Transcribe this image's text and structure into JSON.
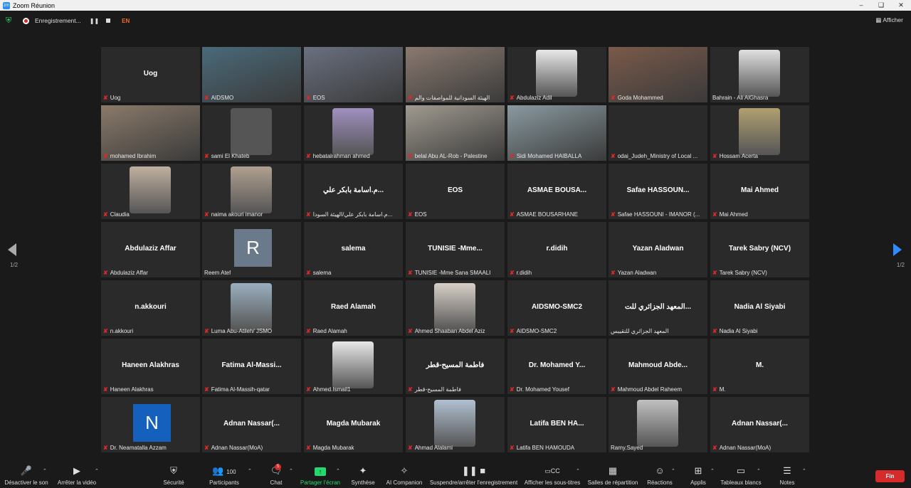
{
  "window": {
    "title": "Zoom Réunion"
  },
  "topbar": {
    "recording_label": "Enregistrement...",
    "language": "EN",
    "view_label": "Afficher"
  },
  "pager": {
    "left": "1/2",
    "right": "1/2"
  },
  "tiles": [
    {
      "name": "Uog",
      "label": "Uog",
      "kind": "text"
    },
    {
      "name": "",
      "label": "AIDSMO",
      "kind": "video",
      "speaker": true,
      "bg": "#4a6a7a"
    },
    {
      "name": "",
      "label": "EOS",
      "kind": "video",
      "bg": "#6a7080"
    },
    {
      "name": "",
      "label": "الهيئة السودانية للمواصفات والم",
      "kind": "video",
      "bg": "#8a7a70"
    },
    {
      "name": "",
      "label": "Abdulaziz Adil",
      "kind": "photo",
      "bg": "#e8e8e8"
    },
    {
      "name": "",
      "label": "Goda Mohammed",
      "kind": "video",
      "bg": "#7a5a4a"
    },
    {
      "name": "",
      "label": "Bahrain - Ali AlGhasra",
      "kind": "photo",
      "bg": "#e0e0e0",
      "nomic": true
    },
    {
      "name": "",
      "label": "mohamed Ibrahim",
      "kind": "video",
      "bg": "#8a7a6a"
    },
    {
      "name": "",
      "label": "sami El Khateb",
      "kind": "photo",
      "bg": "#555"
    },
    {
      "name": "",
      "label": "hebatalrahman ahmed",
      "kind": "photo",
      "bg": "#a090c0"
    },
    {
      "name": "",
      "label": "belal Abu AL-Rob - Palestine",
      "kind": "video",
      "bg": "#a09a90"
    },
    {
      "name": "",
      "label": "Sidi Mohamed HAIBALLA",
      "kind": "video",
      "bg": "#8a9aa0"
    },
    {
      "name": "",
      "label": "odai_Judeh_Ministry of Local ...",
      "kind": "text"
    },
    {
      "name": "",
      "label": "Hossam Acerta",
      "kind": "photo",
      "bg": "#b0a070"
    },
    {
      "name": "",
      "label": "Claudia",
      "kind": "photo",
      "bg": "#c0b0a0"
    },
    {
      "name": "",
      "label": "naima akouri imanor",
      "kind": "photo",
      "bg": "#b0a090"
    },
    {
      "name": "م.اسامة بابكر علي...",
      "label": "م.اسامة بابكر علي/الهيئة السودا...",
      "kind": "text"
    },
    {
      "name": "EOS",
      "label": "EOS",
      "kind": "text"
    },
    {
      "name": "ASMAE  BOUSA...",
      "label": "ASMAE BOUSARHANE",
      "kind": "text"
    },
    {
      "name": "Safae  HASSOUN...",
      "label": "Safae HASSOUNI - IMANOR (...",
      "kind": "text"
    },
    {
      "name": "Mai Ahmed",
      "label": "Mai Ahmed",
      "kind": "text"
    },
    {
      "name": "Abdulaziz Affar",
      "label": "Abdulaziz Affar",
      "kind": "text"
    },
    {
      "name": "R",
      "label": "Reem Atef",
      "kind": "avatar",
      "bg": "#6a7a8a",
      "nomic": true
    },
    {
      "name": "salema",
      "label": "salema",
      "kind": "text"
    },
    {
      "name": "TUNISIE  -Mme...",
      "label": "TUNISIE -Mme Sana SMAALI",
      "kind": "text"
    },
    {
      "name": "r.didih",
      "label": "r.didih",
      "kind": "text"
    },
    {
      "name": "Yazan Aladwan",
      "label": "Yazan Aladwan",
      "kind": "text"
    },
    {
      "name": "Tarek Sabry (NCV)",
      "label": "Tarek Sabry (NCV)",
      "kind": "text"
    },
    {
      "name": "n.akkouri",
      "label": "n.akkouri",
      "kind": "text"
    },
    {
      "name": "",
      "label": "Luma Abu-Atileh/ JSMO",
      "kind": "photo",
      "bg": "#9ab0c0"
    },
    {
      "name": "Raed Alamah",
      "label": "Raed Alamah",
      "kind": "text"
    },
    {
      "name": "",
      "label": "Ahmed Shaaban Abdel Aziz",
      "kind": "photo",
      "bg": "#d8d0c8"
    },
    {
      "name": "AIDSMO-SMC2",
      "label": "AIDSMO-SMC2",
      "kind": "text"
    },
    {
      "name": "المعهد الجزائري للت...",
      "label": "المعهد الجزائري للتقييس",
      "kind": "text",
      "nomic": true
    },
    {
      "name": "Nadia Al Siyabi",
      "label": "Nadia Al Siyabi",
      "kind": "text"
    },
    {
      "name": "Haneen Alakhras",
      "label": "Haneen Alakhras",
      "kind": "text"
    },
    {
      "name": "Fatima  Al-Massi...",
      "label": "Fatima Al-Massih-qatar",
      "kind": "text"
    },
    {
      "name": "",
      "label": "Ahmed.Ismail1",
      "kind": "photo",
      "bg": "#e8e8e8"
    },
    {
      "name": "فاطمة المسيح-قطر",
      "label": "فاطمة المسيح-قطر",
      "kind": "text"
    },
    {
      "name": "Dr.  Mohamed  Y...",
      "label": "Dr. Mohamed Yousef",
      "kind": "text"
    },
    {
      "name": "Mahmoud  Abde...",
      "label": "Mahmoud Abdel Raheem",
      "kind": "text"
    },
    {
      "name": "M.",
      "label": "M.",
      "kind": "text"
    },
    {
      "name": "N",
      "label": "Dr. Neamatalla Azzam",
      "kind": "avatar",
      "bg": "#1560bd"
    },
    {
      "name": "Adnan  Nassar(...",
      "label": "Adnan Nassar(MoA)",
      "kind": "text"
    },
    {
      "name": "Magda Mubarak",
      "label": "Magda Mubarak",
      "kind": "text"
    },
    {
      "name": "",
      "label": "Ahmad Alalami",
      "kind": "photo",
      "bg": "#b0c0d0"
    },
    {
      "name": "Latifa  BEN HA...",
      "label": "Latifa  BEN HAMOUDA",
      "kind": "text"
    },
    {
      "name": "",
      "label": "Ramy.Sayed",
      "kind": "photo",
      "bg": "#c0c0c0",
      "nomic": true
    },
    {
      "name": "Adnan  Nassar(...",
      "label": "Adnan Nassar(MoA)",
      "kind": "text"
    }
  ],
  "toolbar": {
    "mute": "Désactiver le son",
    "video": "Arrêter la vidéo",
    "security": "Sécurité",
    "participants": "Participants",
    "participants_count": "100",
    "chat": "Chat",
    "chat_badge": "5",
    "share": "Partager l'écran",
    "summary": "Synthèse",
    "companion": "AI Companion",
    "record": "Suspendre/arrêter l'enregistrement",
    "captions": "Afficher les sous-titres",
    "rooms": "Salles de répartition",
    "reactions": "Réactions",
    "apps": "Applis",
    "whiteboards": "Tableaux blancs",
    "notes": "Notes",
    "end": "Fin"
  }
}
